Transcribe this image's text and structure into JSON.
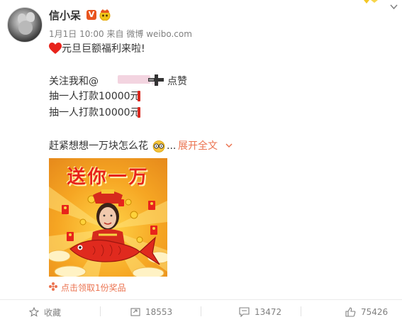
{
  "user": {
    "name": "信小呆",
    "vip_label": "V"
  },
  "meta": {
    "date": "1月1日",
    "time": "10:00",
    "source_prefix": "来自",
    "source": "微博 weibo.com"
  },
  "post": {
    "line1": "元旦巨额福利来啦!",
    "line2_prefix": "关注我和@",
    "line2_suffix": "点赞",
    "line3": "抽一人打款10000元",
    "line4": "抽一人打款10000元",
    "line5_prefix": "赶紧想想一万块怎么花",
    "ellipsis": "...",
    "expand": "展开全文"
  },
  "image": {
    "title": "送你一万"
  },
  "reward": {
    "label": "点击领取1份奖品"
  },
  "actions": {
    "favorite": "收藏",
    "repost": "18553",
    "comment": "13472",
    "like": "75426"
  },
  "colors": {
    "accent": "#eb7350",
    "text": "#333333",
    "meta": "#808080",
    "vip": "#e8541e",
    "red": "#d9281f"
  },
  "icons": [
    "heart-icon",
    "crown-icon",
    "emoji-icon",
    "chevron-down-icon",
    "star-icon",
    "repost-icon",
    "comment-icon",
    "like-icon",
    "reward-icon"
  ]
}
